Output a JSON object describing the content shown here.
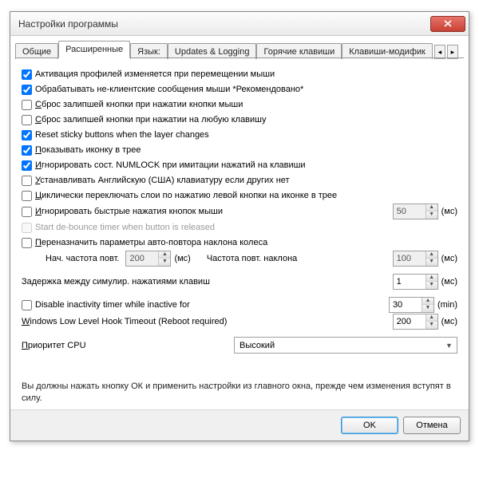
{
  "window": {
    "title": "Настройки программы"
  },
  "tabs": {
    "t0": "Общие",
    "t1": "Расширенные",
    "t2": "Язык:",
    "t3": "Updates & Logging",
    "t4": "Горячие клавиши",
    "t5": "Клавиши-модифик"
  },
  "chk": {
    "c0": "Активация профилей изменяется при перемещении мыши",
    "c1": "Обрабатывать не-клиентские сообщения мыши *Рекомендовано*",
    "c2_pre": "С",
    "c2": "брос залипшей кнопки при нажатии кнопки мыши",
    "c3_pre": "С",
    "c3": "брос залипшей кнопки при нажатии на любую клавишу",
    "c4": "Reset sticky buttons when the layer changes",
    "c5_pre": "П",
    "c5": "оказывать иконку в трее",
    "c6_pre": "И",
    "c6": "гнорировать сост. NUMLOCK при имитации нажатий на клавиши",
    "c7_pre": "У",
    "c7": "станавливать Английскую (США)  клавиатуру если других нет",
    "c8_pre": "Ц",
    "c8": "иклически переключать слои по нажатию левой кнопки на иконке в трее",
    "c9_pre": "И",
    "c9": "гнорировать быстрые нажатия кнопок мыши",
    "c10": "Start de-bounce timer when button is released",
    "c11_pre": "П",
    "c11": "ереназначить параметры авто-повтора наклона колеса",
    "c12": "Disable inactivity timer while inactive for"
  },
  "labels": {
    "repeat_start": "Нач. частота повт.",
    "repeat_tilt": "Частота повт. наклона",
    "sim_delay": "Задержка между симулир. нажатиями клавиш",
    "hook_pre": "W",
    "hook": "indows Low Level Hook Timeout (Reboot required)",
    "cpu_pre": "П",
    "cpu": "риоритет CPU",
    "ms": "(мс)",
    "min": "(min)"
  },
  "values": {
    "debounce": "50",
    "repeat_start": "200",
    "repeat_tilt": "100",
    "sim_delay": "1",
    "inactive": "30",
    "hook": "200",
    "cpu": "Высокий"
  },
  "note": "Вы должны нажать кнопку ОК и применить настройки из главного окна, прежде чем изменения вступят в силу.",
  "buttons": {
    "ok": "OK",
    "cancel": "Отмена"
  }
}
